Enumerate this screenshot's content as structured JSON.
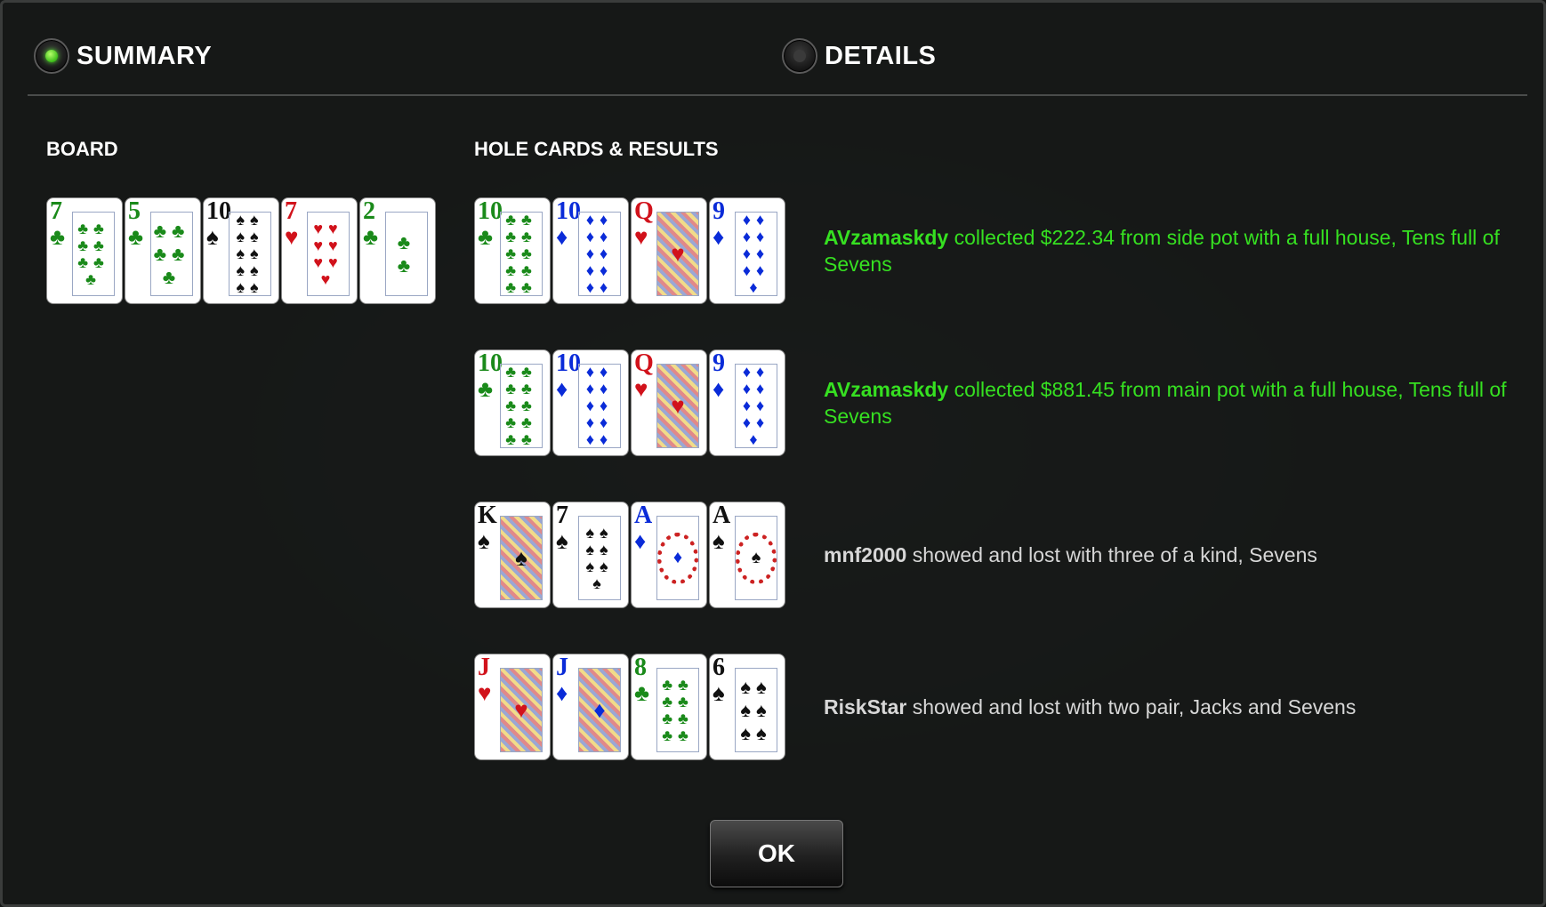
{
  "tabs": [
    {
      "label": "SUMMARY",
      "selected": true
    },
    {
      "label": "DETAILS",
      "selected": false
    }
  ],
  "board": {
    "heading": "BOARD",
    "cards": [
      {
        "rank": "7",
        "suit": "clubs",
        "symbol": "♣",
        "color": "green"
      },
      {
        "rank": "5",
        "suit": "clubs",
        "symbol": "♣",
        "color": "green"
      },
      {
        "rank": "10",
        "suit": "spades",
        "symbol": "♠",
        "color": "black"
      },
      {
        "rank": "7",
        "suit": "hearts",
        "symbol": "♥",
        "color": "red"
      },
      {
        "rank": "2",
        "suit": "clubs",
        "symbol": "♣",
        "color": "green"
      }
    ]
  },
  "hole_cards": {
    "heading": "HOLE CARDS & RESULTS",
    "rows": [
      {
        "cards": [
          {
            "rank": "10",
            "symbol": "♣",
            "color": "green"
          },
          {
            "rank": "10",
            "symbol": "♦",
            "color": "blue"
          },
          {
            "rank": "Q",
            "symbol": "♥",
            "color": "red"
          },
          {
            "rank": "9",
            "symbol": "♦",
            "color": "blue"
          }
        ],
        "player": "AVzamaskdy",
        "text": " collected $222.34 from side pot with a full house, Tens full of Sevens",
        "outcome": "win"
      },
      {
        "cards": [
          {
            "rank": "10",
            "symbol": "♣",
            "color": "green"
          },
          {
            "rank": "10",
            "symbol": "♦",
            "color": "blue"
          },
          {
            "rank": "Q",
            "symbol": "♥",
            "color": "red"
          },
          {
            "rank": "9",
            "symbol": "♦",
            "color": "blue"
          }
        ],
        "player": "AVzamaskdy",
        "text": " collected $881.45 from main pot with a full house, Tens full of Sevens",
        "outcome": "win"
      },
      {
        "cards": [
          {
            "rank": "K",
            "symbol": "♠",
            "color": "black"
          },
          {
            "rank": "7",
            "symbol": "♠",
            "color": "black"
          },
          {
            "rank": "A",
            "symbol": "♦",
            "color": "blue"
          },
          {
            "rank": "A",
            "symbol": "♠",
            "color": "black"
          }
        ],
        "player": "mnf2000",
        "text": " showed and lost with three of a kind, Sevens",
        "outcome": "loss"
      },
      {
        "cards": [
          {
            "rank": "J",
            "symbol": "♥",
            "color": "red"
          },
          {
            "rank": "J",
            "symbol": "♦",
            "color": "blue"
          },
          {
            "rank": "8",
            "symbol": "♣",
            "color": "green"
          },
          {
            "rank": "6",
            "symbol": "♠",
            "color": "black"
          }
        ],
        "player": "RiskStar",
        "text": " showed and lost with two pair, Jacks and Sevens",
        "outcome": "loss"
      }
    ]
  },
  "ok_label": "OK",
  "colors": {
    "win_text": "#36e021",
    "loss_text": "#d7d7d7",
    "radio_on": "#4fe02a"
  }
}
